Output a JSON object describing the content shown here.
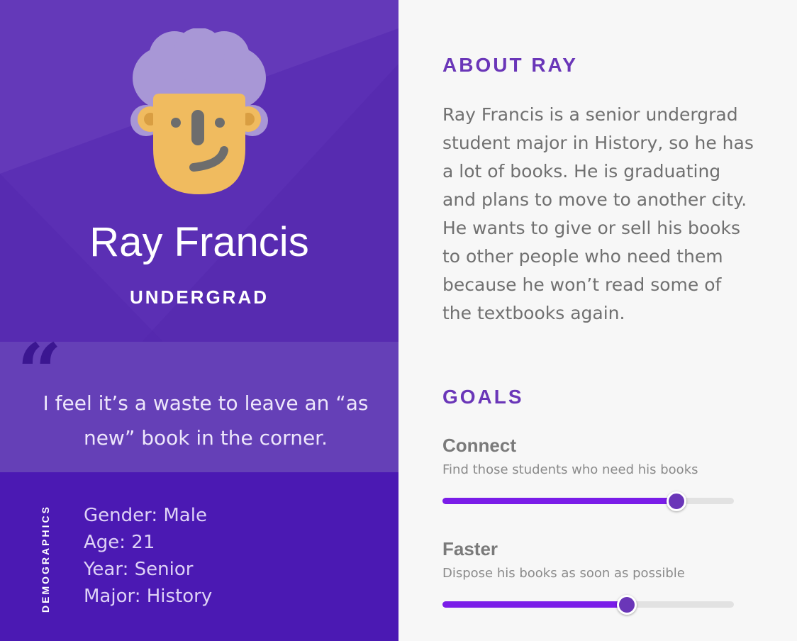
{
  "persona": {
    "name": "Ray Francis",
    "role": "UNDERGRAD",
    "quote_mark": "“",
    "quote": "I feel it’s a waste to leave an “as new” book in the corner."
  },
  "demographics": {
    "label": "DEMOGRAPHICS",
    "items": [
      "Gender: Male",
      "Age: 21",
      "Year: Senior",
      "Major: History"
    ]
  },
  "about": {
    "heading": "ABOUT RAY",
    "text": "Ray Francis is a senior undergrad student major in History, so he has a lot of books. He is graduating and plans to move to another city. He wants to give or sell his books to other people who need them because he won’t read some of the textbooks again."
  },
  "goals": {
    "heading": "GOALS",
    "items": [
      {
        "title": "Connect",
        "description": "Find those students who need his books",
        "level": 0.8
      },
      {
        "title": "Faster",
        "description": "Dispose his books as soon as possible",
        "level": 0.63
      }
    ]
  },
  "colors": {
    "hero": "#5b2fb4",
    "quote_panel": "#6540b7",
    "demographics_panel": "#4b19b3",
    "accent": "#6a36b8",
    "slider_fill": "#7a1de8"
  },
  "icons": {
    "avatar": "cartoon-face-avatar",
    "quote": "quote-mark-icon"
  }
}
